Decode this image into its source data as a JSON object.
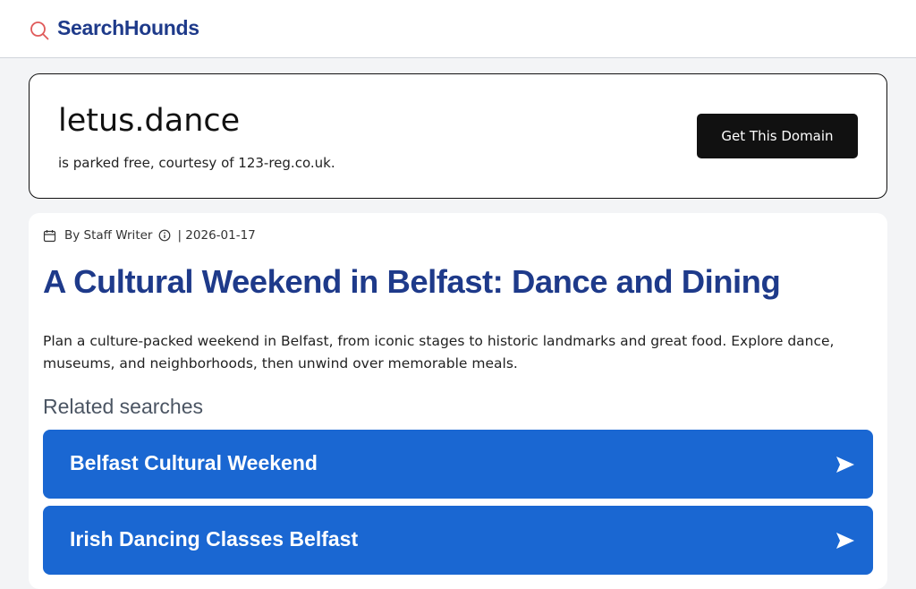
{
  "header": {
    "logo_text": "SearchHounds",
    "logo_icon": "search-icon"
  },
  "domain": {
    "name": "letus.dance",
    "subtitle": "is parked free, courtesy of 123-reg.co.uk.",
    "button_label": "Get This Domain"
  },
  "article": {
    "author": "By Staff Writer",
    "date": "| 2026-01-17",
    "title": "A Cultural Weekend in Belfast: Dance and Dining",
    "body": "Plan a culture-packed weekend in Belfast, from iconic stages to historic landmarks and great food. Explore dance, museums, and neighborhoods, then unwind over memorable meals."
  },
  "related": {
    "heading": "Related searches",
    "items": [
      {
        "label": "Belfast Cultural Weekend"
      },
      {
        "label": "Irish Dancing Classes Belfast"
      }
    ]
  },
  "colors": {
    "brand": "#1e3a8a",
    "related_button": "#1a67d2",
    "logo_icon": "#e05a5a"
  }
}
